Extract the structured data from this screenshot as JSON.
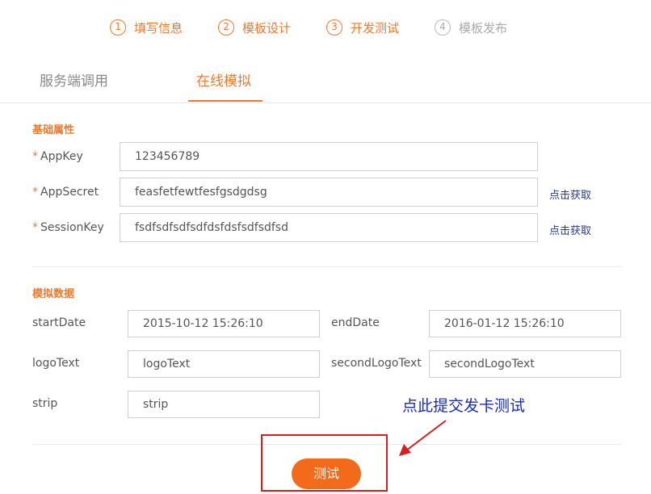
{
  "steps": [
    {
      "num": "1",
      "label": "填写信息",
      "state": "active"
    },
    {
      "num": "2",
      "label": "模板设计",
      "state": "active"
    },
    {
      "num": "3",
      "label": "开发测试",
      "state": "active"
    },
    {
      "num": "4",
      "label": "模板发布",
      "state": "inactive"
    }
  ],
  "tabs": [
    {
      "label": "服务端调用",
      "active": false
    },
    {
      "label": "在线模拟",
      "active": true
    }
  ],
  "basic": {
    "title": "基础属性",
    "required_mark": "*",
    "fetch_label": "点击获取",
    "fields": [
      {
        "label": "AppKey",
        "value": "123456789"
      },
      {
        "label": "AppSecret",
        "value": "feasfetfewtfesfgsdgdsg"
      },
      {
        "label": "SessionKey",
        "value": "fsdfsdfsdfsdfdsfdsfsdfsdfsd"
      }
    ]
  },
  "mock": {
    "title": "模拟数据",
    "fields": {
      "startDate": {
        "label": "startDate",
        "value": "2015-10-12 15:26:10"
      },
      "endDate": {
        "label": "endDate",
        "value": "2016-01-12 15:26:10"
      },
      "logoText": {
        "label": "logoText",
        "value": "logoText"
      },
      "secondLogoText": {
        "label": "secondLogoText",
        "value": "secondLogoText"
      },
      "strip": {
        "label": "strip",
        "value": "strip"
      }
    }
  },
  "annotation": {
    "text": "点此提交发卡测试"
  },
  "submit": {
    "label": "测试"
  },
  "colors": {
    "accent": "#ef7a2f",
    "button": "#f36a1a",
    "annotation": "#1a2bb5",
    "highlight": "#d42020"
  }
}
